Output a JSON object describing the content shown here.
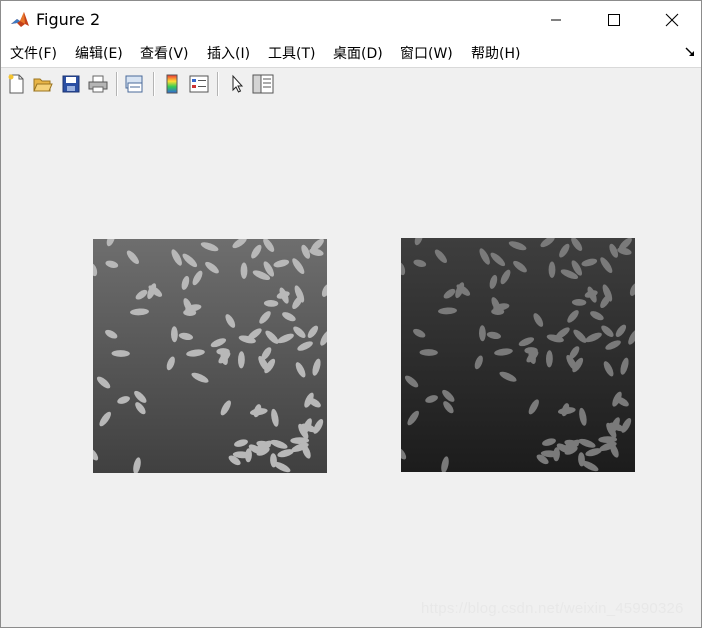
{
  "window": {
    "title": "Figure 2"
  },
  "menu": {
    "items": [
      "文件(F)",
      "编辑(E)",
      "查看(V)",
      "插入(I)",
      "工具(T)",
      "桌面(D)",
      "窗口(W)",
      "帮助(H)"
    ]
  },
  "toolbar": {
    "tools": [
      "new-figure-icon",
      "open-file-icon",
      "save-icon",
      "print-icon",
      "link-plot-icon",
      "insert-colorbar-icon",
      "insert-legend-icon",
      "edit-plot-arrow-icon",
      "property-inspector-icon"
    ]
  },
  "figure": {
    "images": [
      {
        "name": "original-rice-image",
        "background_top": "#6e6e6e",
        "background_bottom": "#404040",
        "grain_color": "#b8b8b8"
      },
      {
        "name": "darkened-rice-image",
        "background_top": "#3e3e3e",
        "background_bottom": "#1c1c1c",
        "grain_color": "#7a7a7a"
      }
    ]
  },
  "watermark": "https://blog.csdn.net/weixin_45990326"
}
